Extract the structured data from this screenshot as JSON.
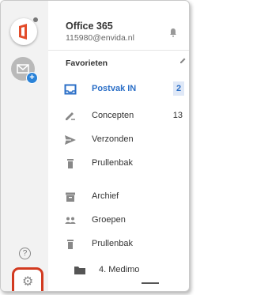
{
  "account": {
    "name": "Office 365",
    "email": "115980@envida.nl"
  },
  "folders": {
    "section_label": "Favorieten"
  },
  "items": [
    {
      "label": "Postvak IN",
      "count": "2",
      "selected": true
    },
    {
      "label": "Concepten",
      "count": "13"
    },
    {
      "label": "Verzonden",
      "count": ""
    },
    {
      "label": "Prullenbak",
      "count": ""
    },
    {
      "label": "Archief",
      "count": ""
    },
    {
      "label": "Groepen",
      "count": ""
    },
    {
      "label": "Prullenbak",
      "count": ""
    },
    {
      "label": "4. Medimo",
      "count": ""
    }
  ],
  "colors": {
    "accent_blue": "#2b6fc7",
    "office_red": "#e34c2a",
    "highlight_ring": "#d23a20"
  },
  "icons": {
    "office": "office-logo-icon",
    "add_account": "plus-icon",
    "help": "help-icon",
    "settings": "gear-icon",
    "bell": "bell-icon",
    "edit": "pencil-icon"
  }
}
